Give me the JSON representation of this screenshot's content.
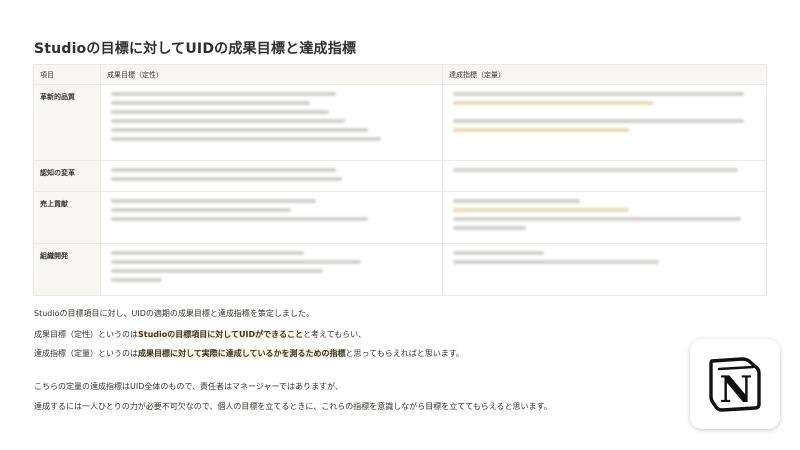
{
  "title": "Studioの目標に対してUIDの成果目標と達成指標",
  "table": {
    "headers": [
      "項目",
      "成果目標（定性）",
      "達成指標（定量）"
    ],
    "rows": [
      {
        "label": "革新的品質"
      },
      {
        "label": "認知の変革"
      },
      {
        "label": "売上貢献"
      },
      {
        "label": "組織開発"
      }
    ]
  },
  "paragraphs": {
    "p1": "Studioの目標項目に対し、UIDの適期の成果目標と達成指標を策定しました。",
    "p2": {
      "a": "成果目標（定性）というのは",
      "b": "Studioの目標項目に対してUIDができること",
      "c": "と考えてもらい、"
    },
    "p3": {
      "a": "達成指標（定量）というのは",
      "b": "成果目標に対して実際に達成しているかを測るための指標",
      "c": "と思ってもらえればと思います。"
    },
    "p4": "こちらの定量の達成指標はUID全体のもので、責任者はマネージャーではありますが、",
    "p5": "達成するには一人ひとりの力が必要不可欠なので、個人の目標を立てるときに、これらの指標を意識しながら目標を立ててもらえると思います。"
  },
  "logo": {
    "icon": "notion-logo-icon",
    "glyph": "N"
  },
  "colors": {
    "text": "#37352f",
    "table_border": "#e9e9e7",
    "header_bg": "#f7f6f3",
    "highlight": "#fbf3db"
  }
}
